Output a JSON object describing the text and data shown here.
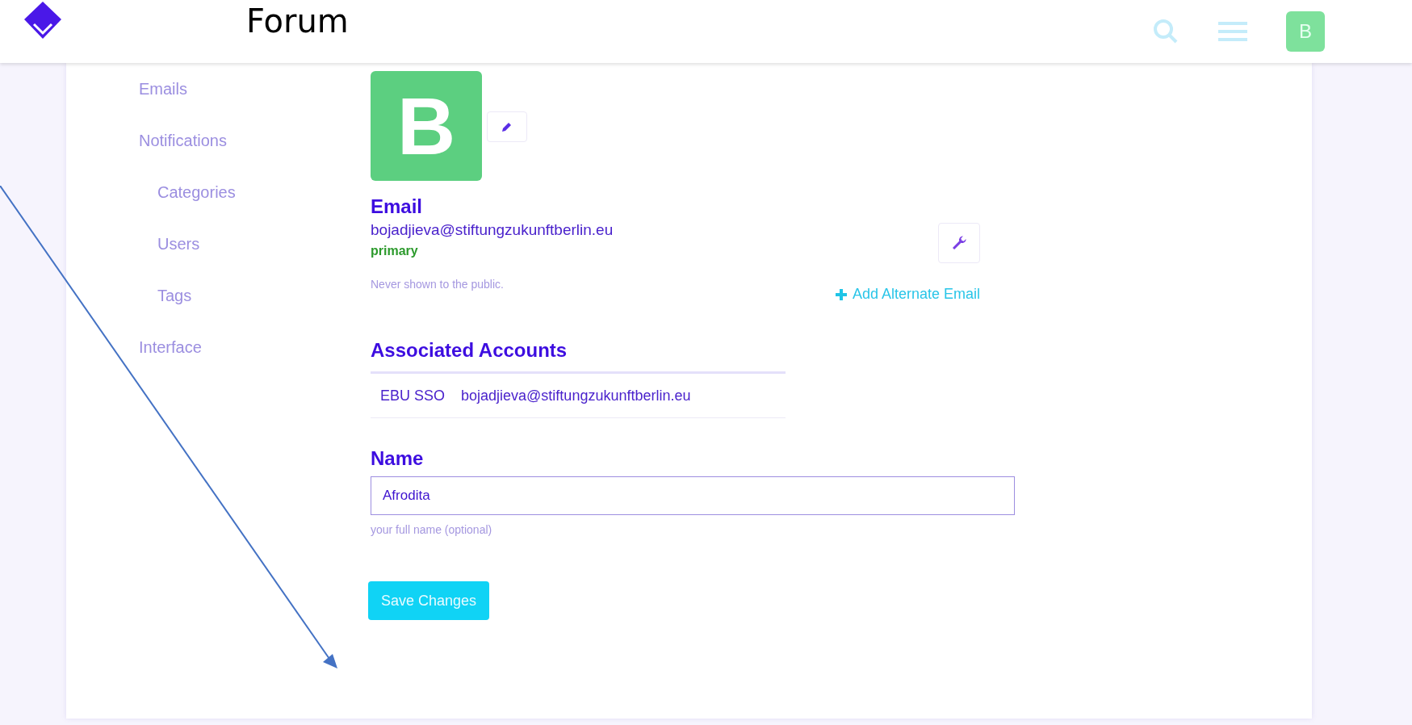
{
  "annotation": {
    "label": "Forum"
  },
  "header": {
    "avatar_letter": "B"
  },
  "sidebar": {
    "items": [
      {
        "label": "Emails"
      },
      {
        "label": "Notifications",
        "children": [
          {
            "label": "Categories"
          },
          {
            "label": "Users"
          },
          {
            "label": "Tags"
          }
        ]
      },
      {
        "label": "Interface"
      }
    ]
  },
  "profile": {
    "avatar_letter": "B"
  },
  "email": {
    "heading": "Email",
    "address": "bojadjieva@stiftungzukunftberlin.eu",
    "badge": "primary",
    "hint": "Never shown to the public.",
    "add_link": "Add Alternate Email"
  },
  "associated_accounts": {
    "heading": "Associated Accounts",
    "rows": [
      {
        "provider": "EBU SSO",
        "account": "bojadjieva@stiftungzukunftberlin.eu"
      }
    ]
  },
  "name": {
    "heading": "Name",
    "value": "Afrodita",
    "hint": "your full name (optional)"
  },
  "save_button": "Save Changes"
}
